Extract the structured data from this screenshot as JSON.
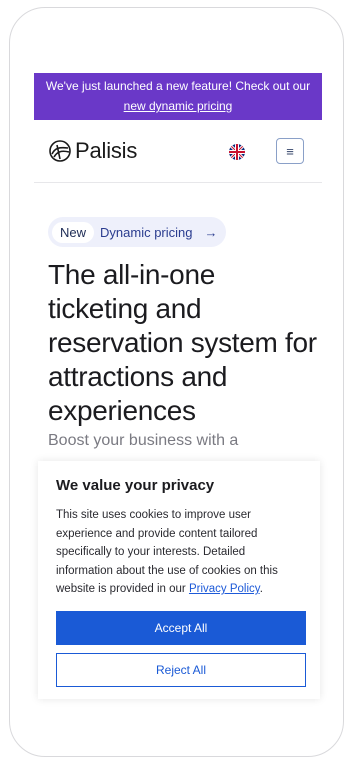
{
  "banner": {
    "text": "We've just launched a new feature! Check out our",
    "link": "new dynamic pricing"
  },
  "navbar": {
    "logo_text": "Palisis",
    "language_icon": "uk-flag-icon",
    "menu_icon": "hamburger-menu-icon",
    "menu_glyph": "≡"
  },
  "hero": {
    "pill_badge": "New",
    "pill_text": "Dynamic pricing",
    "pill_arrow": "→",
    "headline": "The all-in-one ticketing and reservation system for attractions and experiences",
    "subtitle": "Boost your business with a"
  },
  "cookie": {
    "title": "We value your privacy",
    "body": "This site uses cookies to improve user experience and provide content tailored specifically to your interests. Detailed information about the use of cookies on this website is provided in our ",
    "policy_link": "Privacy Policy",
    "body_end": ".",
    "accept_label": "Accept All",
    "reject_label": "Reject All"
  },
  "colors": {
    "banner_bg": "#6a38c8",
    "accent_blue": "#1a5ad6"
  }
}
